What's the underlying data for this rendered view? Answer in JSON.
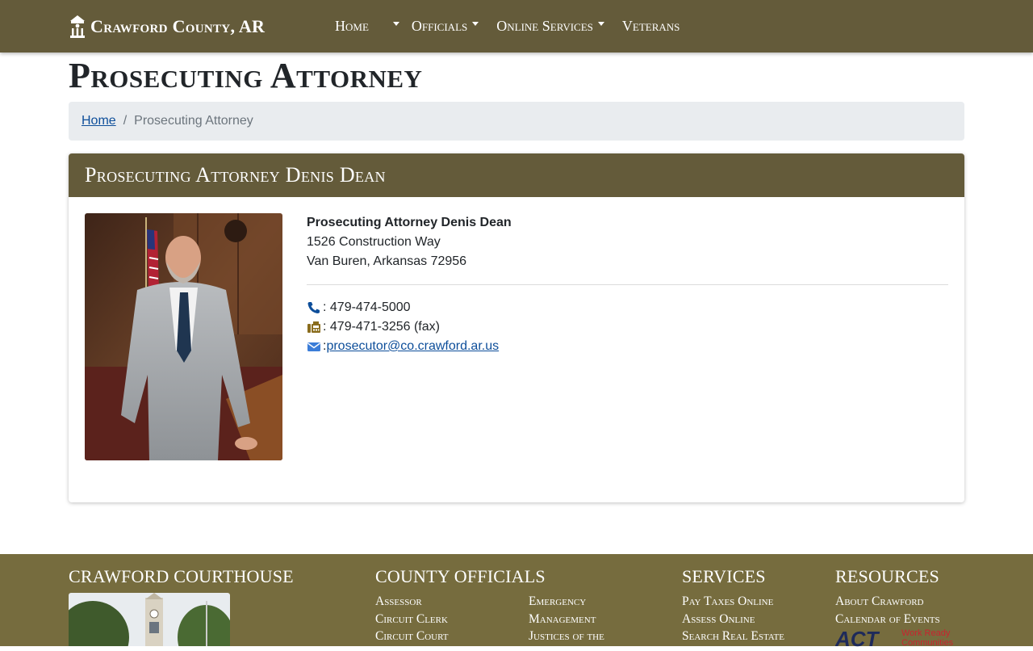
{
  "navbar": {
    "brand": "Crawford County, AR",
    "brand_icon": "courthouse-icon",
    "items": [
      {
        "label": "Home",
        "dropdown": false
      },
      {
        "label": "",
        "dropdown": true
      },
      {
        "label": "Officials",
        "dropdown": true
      },
      {
        "label": "Online Services",
        "dropdown": true
      },
      {
        "label": "Veterans",
        "dropdown": false
      }
    ]
  },
  "page": {
    "title": "Prosecuting Attorney"
  },
  "breadcrumb": {
    "home": "Home",
    "separator": "/",
    "current": "Prosecuting Attorney"
  },
  "card": {
    "header": "Prosecuting Attorney Denis Dean",
    "name": "Prosecuting Attorney Denis Dean",
    "address_line1": "1526 Construction Way",
    "address_line2": "Van Buren, Arkansas 72956",
    "phone": ": 479-474-5000",
    "fax": ": 479-471-3256 (fax)",
    "email_prefix": ": ",
    "email": "prosecutor@co.crawford.ar.us"
  },
  "footer": {
    "courthouse_heading": "CRAWFORD COURTHOUSE",
    "officials_heading": "COUNTY OFFICIALS",
    "officials_col1": [
      "Assessor",
      "Circuit Clerk",
      "Circuit Court"
    ],
    "officials_col2": [
      "Emergency",
      "Management",
      "Justices of the"
    ],
    "services_heading": "SERVICES",
    "services": [
      "Pay Taxes Online",
      "Assess Online",
      "Search Real Estate"
    ],
    "resources_heading": "RESOURCES",
    "resources": [
      "About Crawford",
      "Calendar of Events"
    ],
    "act_logo_text": "ACT",
    "act_logo_sub1": "Work Ready",
    "act_logo_sub2": "Communities"
  },
  "colors": {
    "nav_bg": "#645b3a",
    "footer_bg": "#766c3e",
    "link": "#0d4e9a",
    "breadcrumb_bg": "#e9ecef"
  }
}
